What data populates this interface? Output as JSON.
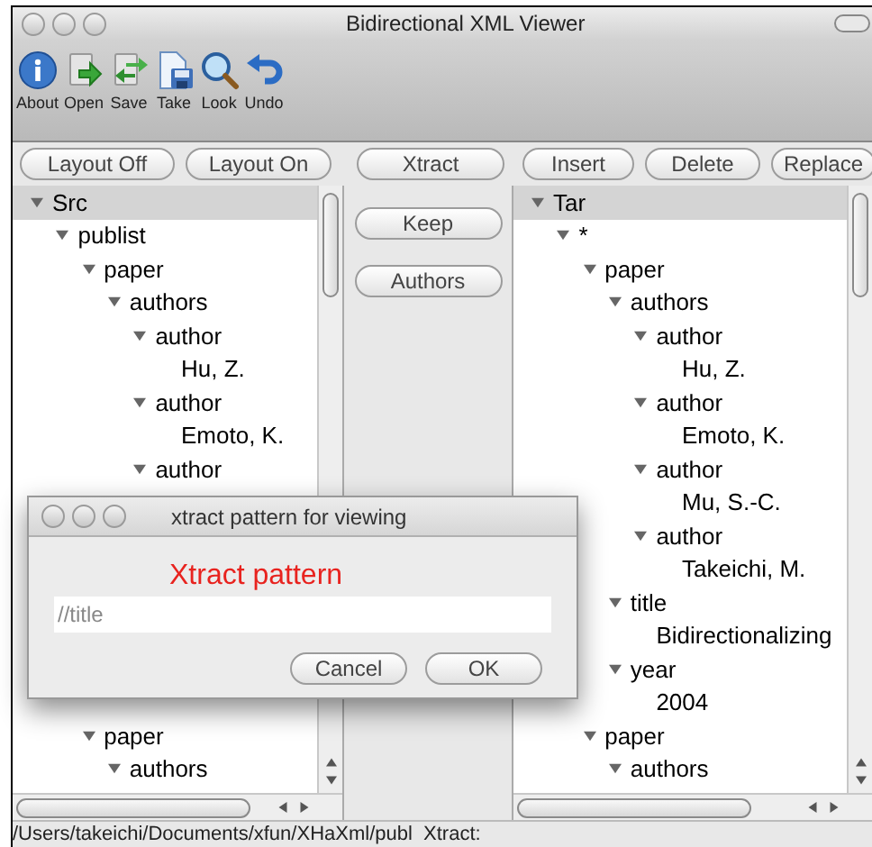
{
  "window": {
    "title": "Bidirectional XML Viewer"
  },
  "toolbar": [
    {
      "kind": "about",
      "label": "About"
    },
    {
      "kind": "open",
      "label": "Open"
    },
    {
      "kind": "save",
      "label": "Save"
    },
    {
      "kind": "take",
      "label": "Take"
    },
    {
      "kind": "look",
      "label": "Look"
    },
    {
      "kind": "undo",
      "label": "Undo"
    }
  ],
  "left_buttons": [
    "Layout Off",
    "Layout On"
  ],
  "middle_buttons": [
    "Xtract",
    "Keep",
    "Authors"
  ],
  "right_buttons": [
    "Insert",
    "Delete",
    "Replace"
  ],
  "source_tree": {
    "upper": [
      {
        "label": "Src",
        "expanded": true,
        "children": [
          {
            "label": "publist",
            "expanded": true,
            "children": [
              {
                "label": "paper",
                "expanded": true,
                "children": [
                  {
                    "label": "authors",
                    "expanded": true,
                    "children": [
                      {
                        "label": "author",
                        "expanded": true,
                        "children": [
                          {
                            "label": "Hu, Z."
                          }
                        ]
                      },
                      {
                        "label": "author",
                        "expanded": true,
                        "children": [
                          {
                            "label": "Emoto, K."
                          }
                        ]
                      },
                      {
                        "label": "author",
                        "expanded": true
                      }
                    ]
                  }
                ]
              }
            ]
          }
        ]
      }
    ],
    "lower": [
      {
        "kind": "element",
        "label": "paper",
        "expanded": true,
        "children": [
          {
            "label": "authors",
            "expanded": true
          }
        ]
      }
    ]
  },
  "target_tree": [
    {
      "label": "Tar",
      "expanded": true,
      "children": [
        {
          "label": "*",
          "expanded": true,
          "children": [
            {
              "label": "paper",
              "expanded": true,
              "children": [
                {
                  "label": "authors",
                  "expanded": true,
                  "children": [
                    {
                      "label": "author",
                      "expanded": true,
                      "children": [
                        {
                          "label": "Hu, Z."
                        }
                      ]
                    },
                    {
                      "label": "author",
                      "expanded": true,
                      "children": [
                        {
                          "label": "Emoto, K."
                        }
                      ]
                    },
                    {
                      "label": "author",
                      "expanded": true,
                      "children": [
                        {
                          "label": "Mu, S.-C."
                        }
                      ]
                    },
                    {
                      "label": "author",
                      "expanded": true,
                      "children": [
                        {
                          "label": "Takeichi, M."
                        }
                      ]
                    }
                  ]
                },
                {
                  "label": "title",
                  "expanded": true,
                  "children": [
                    {
                      "label": "Bidirectionalizing"
                    }
                  ]
                },
                {
                  "label": "year",
                  "expanded": true,
                  "children": [
                    {
                      "label": "2004"
                    }
                  ]
                }
              ]
            },
            {
              "label": "paper",
              "expanded": true,
              "children": [
                {
                  "label": "authors",
                  "expanded": true
                }
              ]
            }
          ]
        }
      ]
    }
  ],
  "status_bar": "/Users/takeichi/Documents/xfun/XHaXml/publ  Xtract:",
  "dialog": {
    "title": "xtract pattern for viewing",
    "annotation": "Xtract pattern",
    "value": "//title",
    "buttons": [
      "Cancel",
      "OK"
    ]
  }
}
